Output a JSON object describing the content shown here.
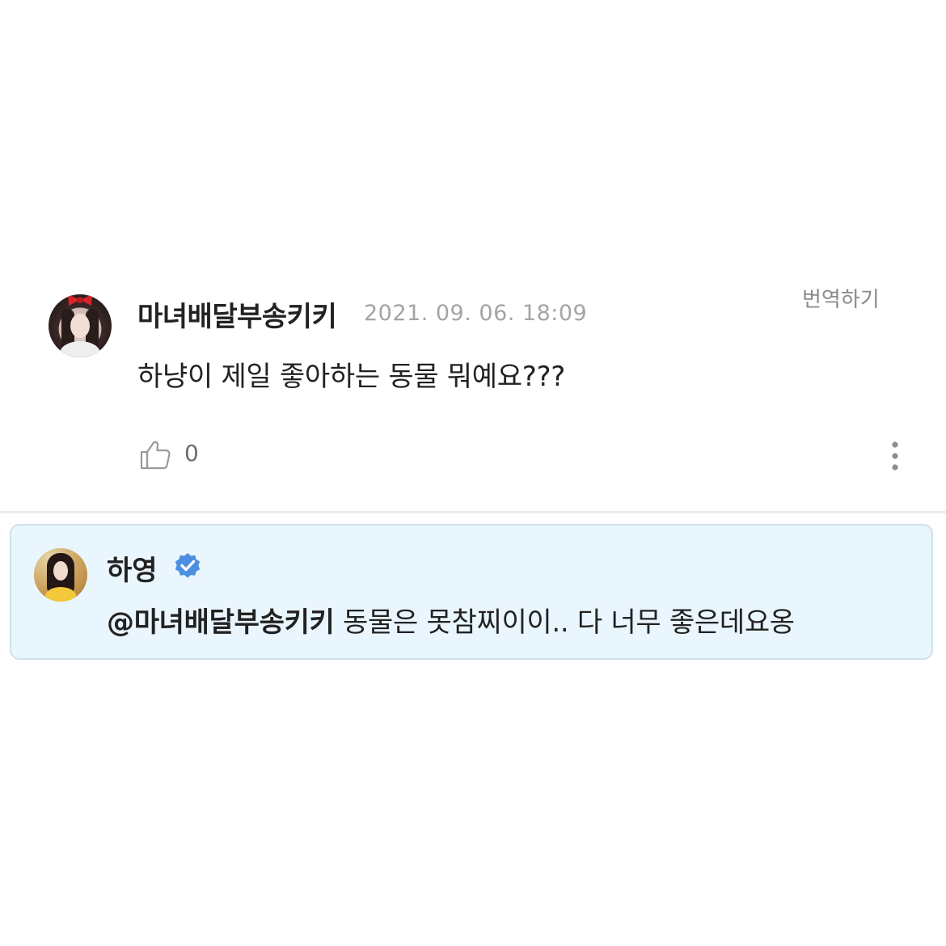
{
  "comment": {
    "author": "마녀배달부송키키",
    "timestamp": "2021. 09. 06. 18:09",
    "translate_label": "번역하기",
    "text": "하냥이 제일 좋아하는 동물 뭐예요???",
    "like_count": "0",
    "like_icon": "thumbs-up-icon",
    "more_icon": "more-vertical-icon"
  },
  "reply": {
    "author": "하영",
    "verified_icon": "verified-badge-icon",
    "mention": "@마녀배달부송키키",
    "text": " 동물은 못참찌이이.. 다 너무 좋은데요옹",
    "background_color": "#eaf6fd",
    "border_color": "#cde1ee",
    "badge_color": "#4c8fe0"
  }
}
